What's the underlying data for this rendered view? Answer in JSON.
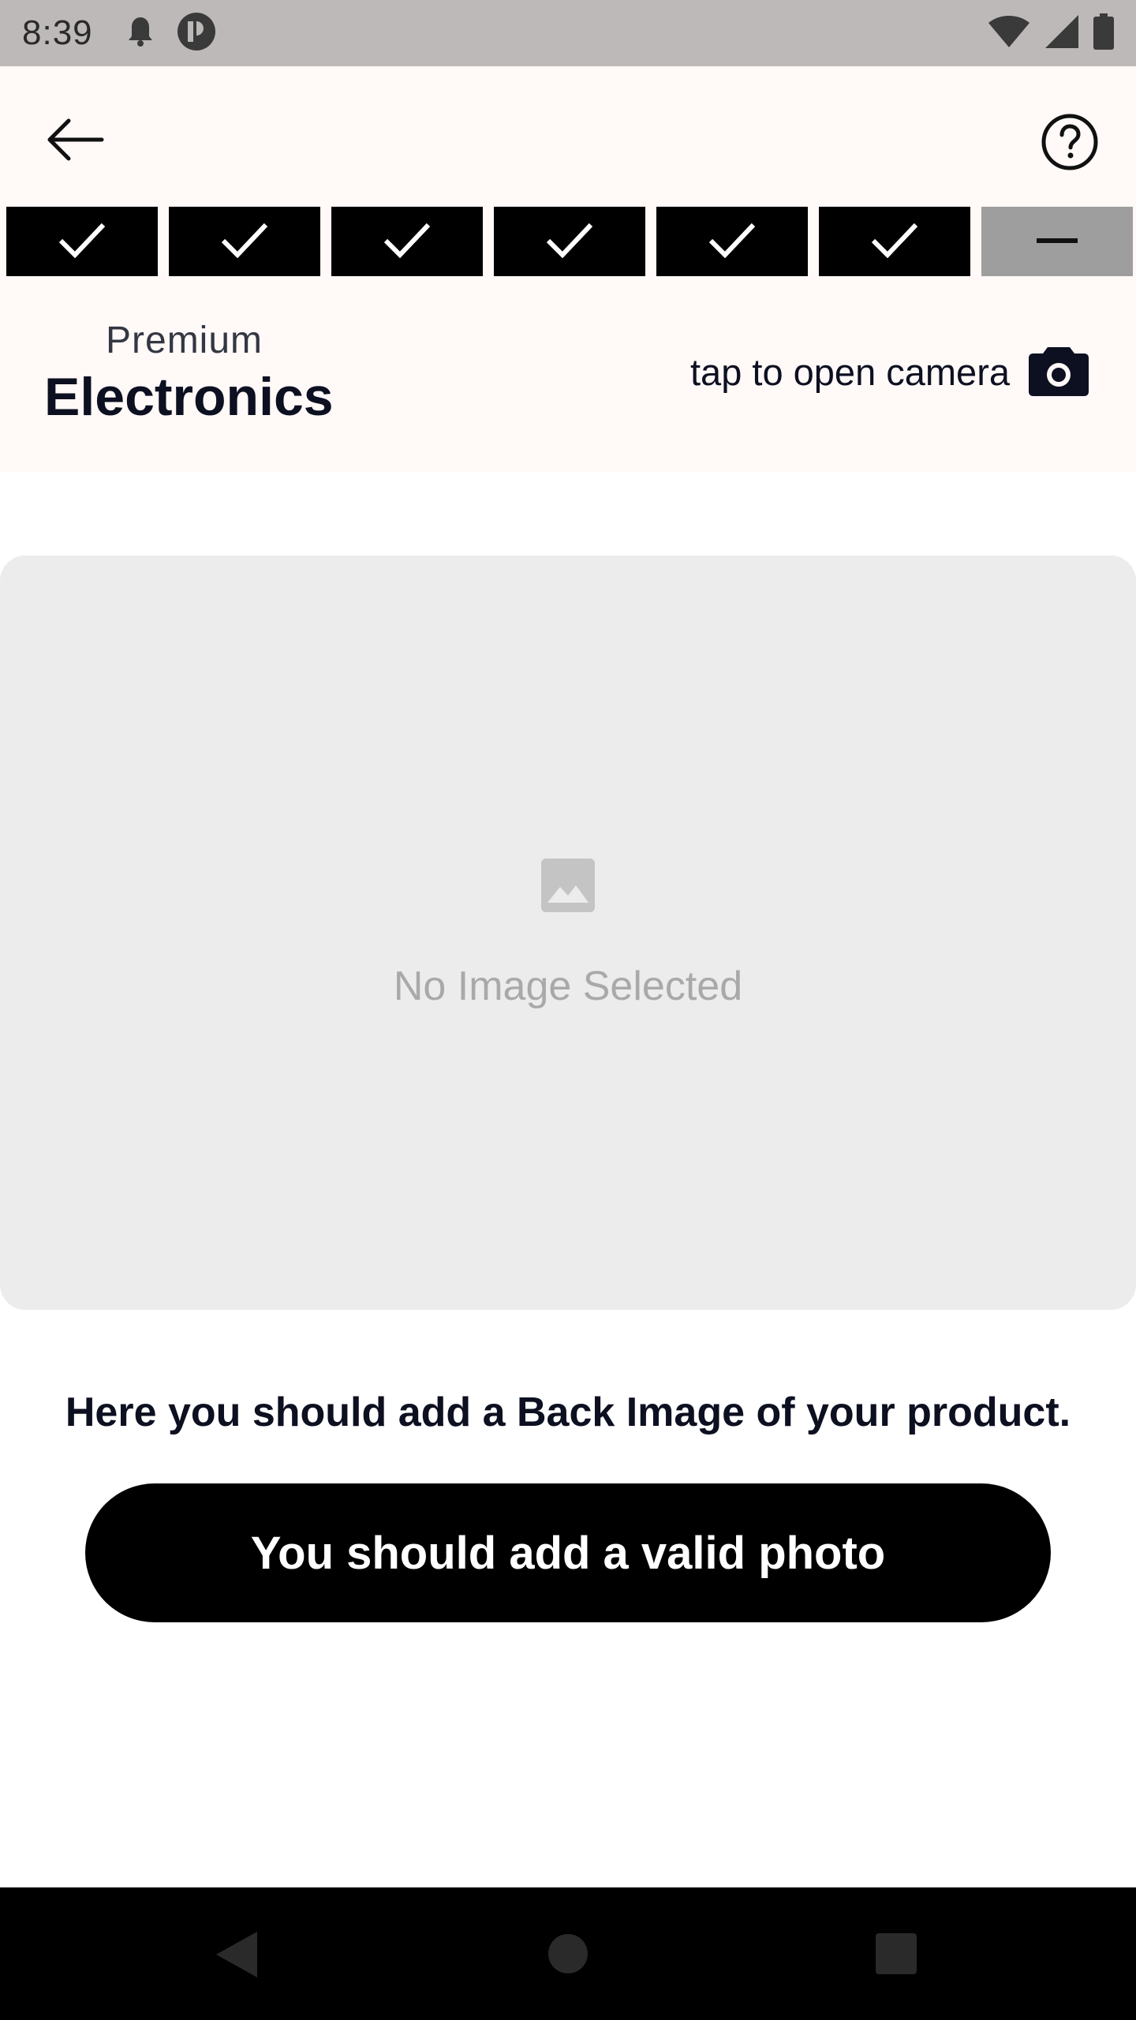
{
  "status_bar": {
    "time": "8:39",
    "icons_left": [
      "notification-bell-icon",
      "app-status-icon"
    ],
    "icons_right": [
      "wifi-icon",
      "cellular-signal-icon",
      "battery-icon"
    ]
  },
  "header": {
    "back_icon": "arrow-left-icon",
    "help_icon": "help-circle-icon",
    "steps": [
      {
        "state": "completed",
        "icon": "check-icon"
      },
      {
        "state": "completed",
        "icon": "check-icon"
      },
      {
        "state": "completed",
        "icon": "check-icon"
      },
      {
        "state": "completed",
        "icon": "check-icon"
      },
      {
        "state": "completed",
        "icon": "check-icon"
      },
      {
        "state": "completed",
        "icon": "check-icon"
      },
      {
        "state": "pending",
        "icon": "dash-icon"
      }
    ],
    "category_subtitle": "Premium",
    "category_title": "Electronics",
    "camera_label": "tap to open camera",
    "camera_icon": "camera-icon"
  },
  "image_box": {
    "placeholder_icon": "image-icon",
    "empty_text": "No Image Selected"
  },
  "instruction_text": "Here you should add a Back Image of your product.",
  "primary_button_label": "You should add a valid photo",
  "colors": {
    "accent": "#000000",
    "header_bg": "#fff9f8",
    "status_bar_bg": "#bdb9b8",
    "pending_step": "#9e9e9e",
    "image_box_bg": "#ececec"
  }
}
